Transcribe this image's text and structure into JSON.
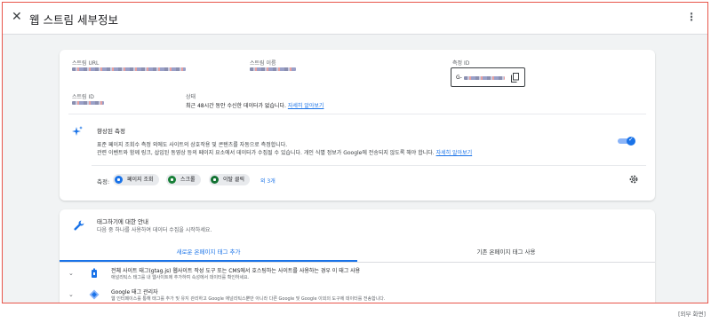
{
  "topbar": {
    "close_icon": "✕",
    "title": "웹 스트림 세부정보",
    "more_icon": "⋮"
  },
  "details": {
    "stream_url_label": "스트림 URL",
    "stream_name_label": "스트림 이름",
    "measurement_id_label": "측정 ID",
    "measurement_id_prefix": "G-",
    "stream_id_label": "스트림 ID",
    "status_label": "상태",
    "status_text": "최근 48시간 동안 수신한 데이터가 없습니다.",
    "status_link": "자세히 알아보기"
  },
  "enhanced": {
    "title": "향상된 측정",
    "desc1": "표준 페이지 조회수 측정 외에도 사이트의 상호작용 및 콘텐츠를 자동으로 측정합니다.",
    "desc2": "관련 이벤트와 함께 링크, 삽입된 동영상 등의 페이지 요소에서 데이터가 수집될 수 있습니다. 개인 식별 정보가 Google에 전송되지 않도록 해야 합니다.",
    "desc_link": "자세히 알아보기",
    "toggle_on": true,
    "measuring_label": "측정:",
    "chips": [
      "페이지 조회",
      "스크롤",
      "이탈 클릭"
    ],
    "more_link": "외 3개",
    "colors": {
      "blue": "#1a73e8",
      "green": "#188038",
      "teal": "#137333"
    }
  },
  "tagging": {
    "title": "태그하기에 대한 안내",
    "subtitle": "다음 중 하나를 사용하여 데이터 수집을 시작하세요.",
    "tabs": [
      "새로운 온페이지 태그 추가",
      "기존 온페이지 태그 사용"
    ],
    "active_tab": 0,
    "items": [
      {
        "title": "전체 사이트 태그(gtag.js) 웹사이트 작성 도구 또는 CMS에서 호스팅하는 사이트를 사용하는 경우 이 태그 사용",
        "desc": "애널리틱스 태그를 내 웹사이트에 추가하여 속성에서 데이터를 확인하세요.",
        "icon": "lock-tag-icon"
      },
      {
        "title": "Google 태그 관리자",
        "desc": "웹 인터페이스를 통해 태그를 추가 및 유지 관리하고 Google 애널리틱스뿐만 아니라 다른 Google 및 Google 이외의 도구에 데이터를 전송합니다.",
        "icon": "tag-manager-icon"
      }
    ]
  },
  "footnote": "[외부 화면]"
}
